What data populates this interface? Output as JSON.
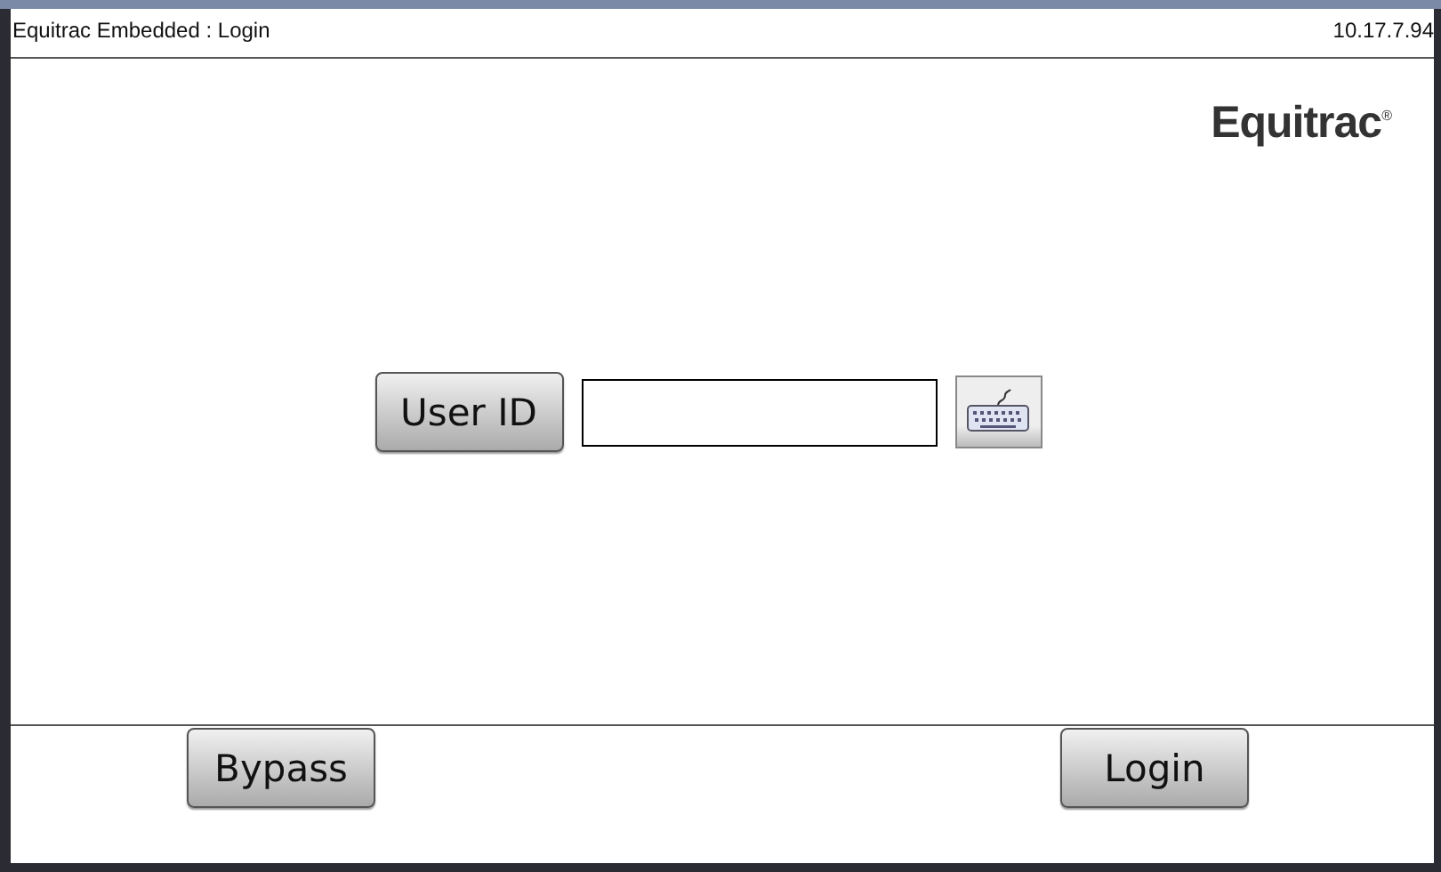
{
  "header": {
    "title": "Equitrac Embedded : Login",
    "address": "10.17.7.94"
  },
  "logo": "Equitrac$^{®}$",
  "login_form": {
    "label_button": "User ID"
  },
  "footer_buttons": [
    {
      "label": "Bypass"
    },
    {
      "label": "Login"
    }
  ]
}
